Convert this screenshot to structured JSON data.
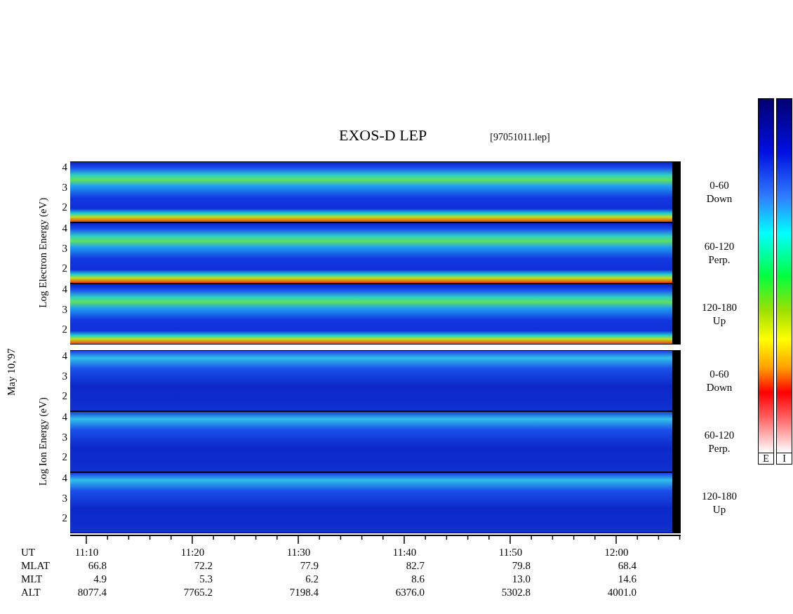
{
  "title": "EXOS-D LEP",
  "file": "[97051011.lep]",
  "date": "May 10,'97",
  "groups": [
    {
      "kind": "electron",
      "ylabel": "Log Electron Energy (eV)",
      "panels": [
        {
          "yticks": [
            "4",
            "3",
            "2"
          ],
          "angle": "0-60",
          "direction": "Down"
        },
        {
          "yticks": [
            "4",
            "3",
            "2"
          ],
          "angle": "60-120",
          "direction": "Perp."
        },
        {
          "yticks": [
            "4",
            "3",
            "2"
          ],
          "angle": "120-180",
          "direction": "Up"
        }
      ]
    },
    {
      "kind": "ion",
      "ylabel": "Log Ion Energy (eV)",
      "panels": [
        {
          "yticks": [
            "4",
            "3",
            "2"
          ],
          "angle": "0-60",
          "direction": "Down"
        },
        {
          "yticks": [
            "4",
            "3",
            "2"
          ],
          "angle": "60-120",
          "direction": "Perp."
        },
        {
          "yticks": [
            "4",
            "3",
            "2"
          ],
          "angle": "120-180",
          "direction": "Up"
        }
      ]
    }
  ],
  "time_rows": [
    {
      "kind": "time",
      "label": "UT",
      "values": [
        "11:10",
        "11:20",
        "11:30",
        "11:40",
        "11:50",
        "12:00"
      ]
    },
    {
      "kind": "number",
      "label": "MLAT",
      "values": [
        "66.8",
        "72.2",
        "77.9",
        "82.7",
        "79.8",
        "68.4"
      ]
    },
    {
      "kind": "number",
      "label": "MLT",
      "values": [
        "4.9",
        "5.3",
        "6.2",
        "8.6",
        "13.0",
        "14.6"
      ]
    },
    {
      "kind": "number",
      "label": "ALT",
      "values": [
        "8077.4",
        "7765.2",
        "7198.4",
        "6376.0",
        "5302.8",
        "4001.0"
      ]
    }
  ],
  "colorbars": [
    {
      "label": "E"
    },
    {
      "label": "I"
    }
  ]
}
